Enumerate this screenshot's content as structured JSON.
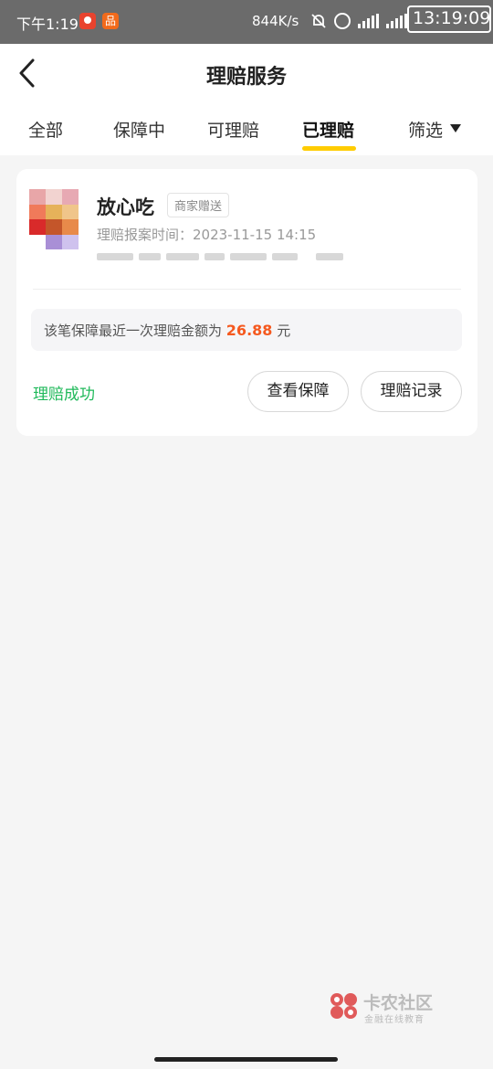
{
  "status_bar": {
    "time": "下午1:19",
    "app2_icon_text": "品",
    "network_speed": "844K/s",
    "clock_badge": "13:19:09",
    "icons": [
      "muted-bell-icon",
      "alarm-icon",
      "signal-icon",
      "wifi-signal-icon"
    ]
  },
  "header": {
    "title": "理赔服务",
    "back_icon": "chevron-left-icon"
  },
  "tabs": [
    {
      "label": "全部",
      "active": false
    },
    {
      "label": "保障中",
      "active": false
    },
    {
      "label": "可理赔",
      "active": false
    },
    {
      "label": "已理赔",
      "active": true
    },
    {
      "label": "筛选",
      "active": false
    }
  ],
  "colors": {
    "accent_underline": "#ffcc00",
    "amount": "#f5591f",
    "success": "#1fb95a"
  },
  "claim_card": {
    "product_name": "放心吃",
    "badge": "商家赠送",
    "report_time": "理赔报案时间：2023-11-15  14:15",
    "info_prefix": "该笔保障最近一次理赔金额为",
    "amount": "26.88",
    "unit": "元",
    "status": "理赔成功",
    "view_button": "查看保障",
    "record_button": "理赔记录"
  },
  "watermark": {
    "name": "卡农社区",
    "tagline": "金融在线教育"
  }
}
